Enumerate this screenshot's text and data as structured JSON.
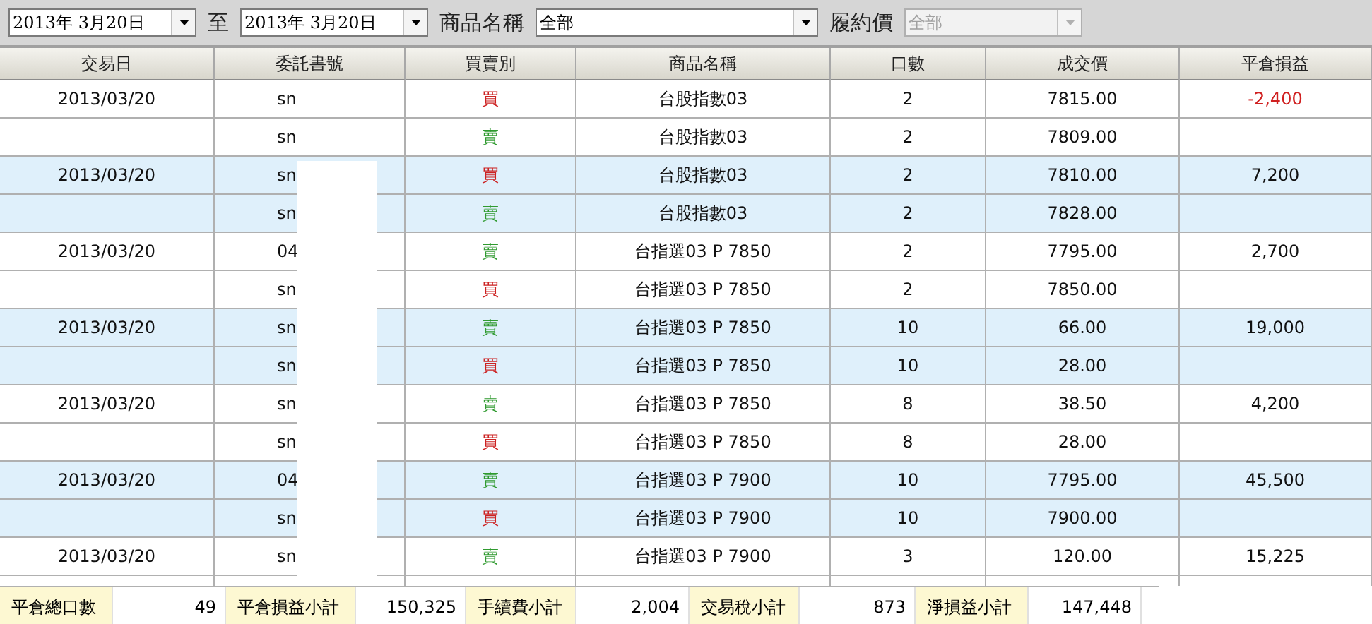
{
  "filters": [
    {
      "kind": "date",
      "value": "2013年  3月20日"
    },
    {
      "kind": "sep",
      "label": "至"
    },
    {
      "kind": "date",
      "value": "2013年  3月20日"
    },
    {
      "kind": "label",
      "label": "商品名稱"
    },
    {
      "kind": "select",
      "value": "全部",
      "disabled": false
    },
    {
      "kind": "label",
      "label": "履約價"
    },
    {
      "kind": "select",
      "value": "全部",
      "disabled": true
    }
  ],
  "table": {
    "columns": [
      "交易日",
      "委託書號",
      "買賣別",
      "商品名稱",
      "口數",
      "成交價",
      "平倉損益"
    ],
    "rows": [
      {
        "shaded": false,
        "date": "2013/03/20",
        "order": "sn",
        "side": {
          "text": "買",
          "color": "#cc2222"
        },
        "product": "台股指數03",
        "qty": "2",
        "price": "7815.00",
        "pnl": {
          "text": "-2,400",
          "negative": true
        }
      },
      {
        "shaded": false,
        "order": "sn",
        "side": {
          "text": "賣",
          "color": "#2f9a2f"
        },
        "product": "台股指數03",
        "qty": "2",
        "price": "7809.00"
      },
      {
        "shaded": true,
        "date": "2013/03/20",
        "order": "sn",
        "side": {
          "text": "買",
          "color": "#cc2222"
        },
        "product": "台股指數03",
        "qty": "2",
        "price": "7810.00",
        "pnl": {
          "text": "7,200",
          "negative": false
        }
      },
      {
        "shaded": true,
        "order": "sn",
        "side": {
          "text": "賣",
          "color": "#2f9a2f"
        },
        "product": "台股指數03",
        "qty": "2",
        "price": "7828.00"
      },
      {
        "shaded": false,
        "date": "2013/03/20",
        "order": "04",
        "side": {
          "text": "賣",
          "color": "#2f9a2f"
        },
        "product": "台指選03 P 7850",
        "qty": "2",
        "price": "7795.00",
        "pnl": {
          "text": "2,700",
          "negative": false
        }
      },
      {
        "shaded": false,
        "order": "sn",
        "side": {
          "text": "買",
          "color": "#cc2222"
        },
        "product": "台指選03 P 7850",
        "qty": "2",
        "price": "7850.00"
      },
      {
        "shaded": true,
        "date": "2013/03/20",
        "order": "sn",
        "side": {
          "text": "賣",
          "color": "#2f9a2f"
        },
        "product": "台指選03 P 7850",
        "qty": "10",
        "price": "66.00",
        "pnl": {
          "text": "19,000",
          "negative": false
        }
      },
      {
        "shaded": true,
        "order": "sn",
        "side": {
          "text": "買",
          "color": "#cc2222"
        },
        "product": "台指選03 P 7850",
        "qty": "10",
        "price": "28.00"
      },
      {
        "shaded": false,
        "date": "2013/03/20",
        "order": "sn",
        "side": {
          "text": "賣",
          "color": "#2f9a2f"
        },
        "product": "台指選03 P 7850",
        "qty": "8",
        "price": "38.50",
        "pnl": {
          "text": "4,200",
          "negative": false
        }
      },
      {
        "shaded": false,
        "order": "sn",
        "side": {
          "text": "買",
          "color": "#cc2222"
        },
        "product": "台指選03 P 7850",
        "qty": "8",
        "price": "28.00"
      },
      {
        "shaded": true,
        "date": "2013/03/20",
        "order": "04",
        "side": {
          "text": "賣",
          "color": "#2f9a2f"
        },
        "product": "台指選03 P 7900",
        "qty": "10",
        "price": "7795.00",
        "pnl": {
          "text": "45,500",
          "negative": false
        }
      },
      {
        "shaded": true,
        "order": "sn",
        "side": {
          "text": "買",
          "color": "#cc2222"
        },
        "product": "台指選03 P 7900",
        "qty": "10",
        "price": "7900.00"
      },
      {
        "shaded": false,
        "date": "2013/03/20",
        "order": "sn",
        "side": {
          "text": "賣",
          "color": "#2f9a2f"
        },
        "product": "台指選03 P 7900",
        "qty": "3",
        "price": "120.00",
        "pnl": {
          "text": "15,225",
          "negative": false
        }
      }
    ]
  },
  "summary": [
    {
      "label": "平倉總口數",
      "value": "49"
    },
    {
      "label": "平倉損益小計",
      "value": "150,325"
    },
    {
      "label": "手續費小計",
      "value": "2,004"
    },
    {
      "label": "交易稅小計",
      "value": "873"
    },
    {
      "label": "淨損益小計",
      "value": "147,448"
    }
  ]
}
